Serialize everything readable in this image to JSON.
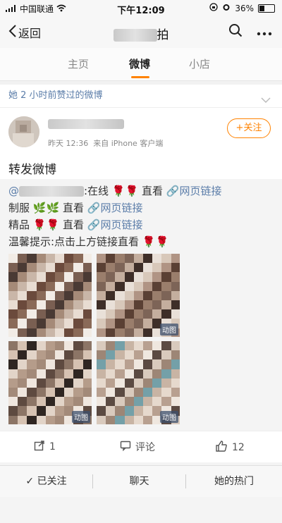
{
  "status_bar": {
    "carrier": "中国联通",
    "time": "下午12:09",
    "battery": "36%",
    "battery_level": 0.36
  },
  "nav": {
    "back_label": "返回",
    "title": "拍"
  },
  "tabs": [
    {
      "label": "主页"
    },
    {
      "label": "微博"
    },
    {
      "label": "小店"
    }
  ],
  "card": {
    "header": "她 2 小时前赞过的微博",
    "meta_time": "昨天 12:36",
    "meta_source": "来自 iPhone 客户端",
    "follow_label": "+关注",
    "post_text": "转发微博"
  },
  "repost": {
    "line1_mid": ":在线",
    "watch": "直看",
    "link": "网页链接",
    "line2_prefix": "制服",
    "line3_prefix": "精品",
    "line4": "温馨提示:点击上方链接直看",
    "gif_label": "动图"
  },
  "actions": {
    "repost_count": "1",
    "comment_label": "评论",
    "like_count": "12"
  },
  "bottom": {
    "followed": "已关注",
    "chat": "聊天",
    "hot": "她的热门"
  }
}
